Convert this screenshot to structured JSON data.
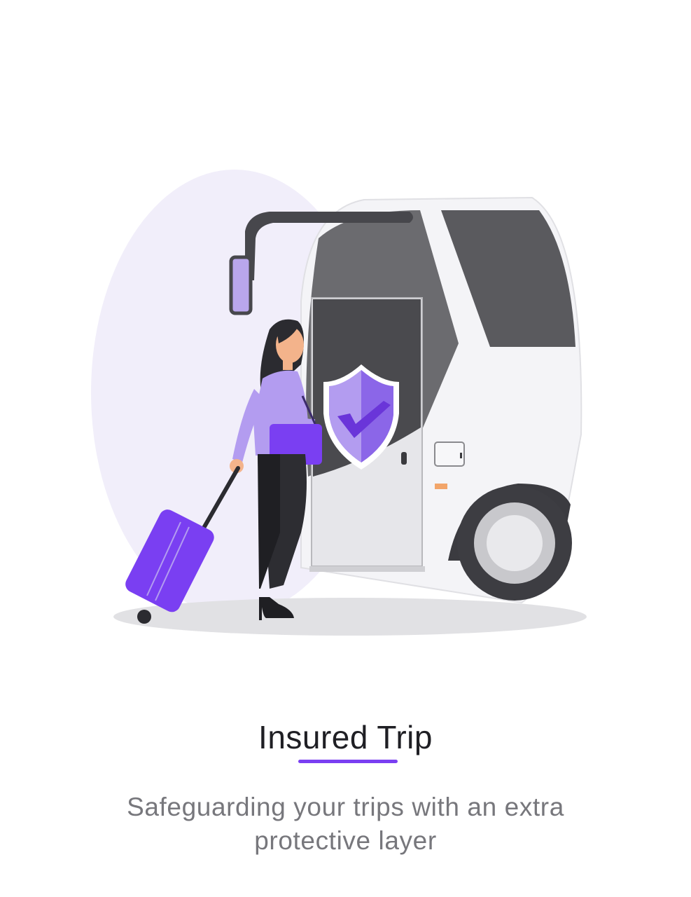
{
  "onboarding": {
    "title": "Insured Trip",
    "subtitle": "Safeguarding your trips with an extra protective layer"
  },
  "illustration": {
    "icon": "shield-check-icon"
  },
  "colors": {
    "accent": "#7a3ff2",
    "accent_light": "#b39cf0",
    "blob_bg": "#f1eefa",
    "title_text": "#1f1f24",
    "subtitle_text": "#77777c"
  }
}
